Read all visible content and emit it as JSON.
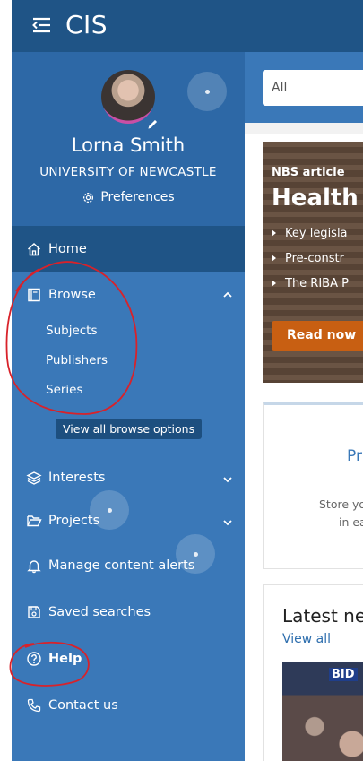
{
  "app": {
    "title": "CIS"
  },
  "profile": {
    "name": "Lorna Smith",
    "organization": "UNIVERSITY OF NEWCASTLE",
    "preferences_label": "Preferences"
  },
  "nav": {
    "home": "Home",
    "browse": {
      "label": "Browse",
      "items": [
        "Subjects",
        "Publishers",
        "Series"
      ],
      "view_all": "View all browse options"
    },
    "interests": "Interests",
    "projects": "Projects",
    "alerts": "Manage content alerts",
    "saved_searches": "Saved searches",
    "help": "Help",
    "contact": "Contact us"
  },
  "search": {
    "scope": "All"
  },
  "article": {
    "kicker": "NBS article",
    "title": "Health",
    "bullets": [
      "Key legisla",
      "Pre-constr",
      "The RIBA P"
    ],
    "cta": "Read now"
  },
  "promo": {
    "title": "Pr",
    "text_line1": "Store yo",
    "text_line2": "in ea"
  },
  "news": {
    "title": "Latest ne",
    "view_all": "View all",
    "image_text": "BID"
  },
  "colors": {
    "sidebar": "#3a78b8",
    "topbar": "#1f5486",
    "profile_bg": "#2d68a6",
    "cta": "#c85f12",
    "annotation": "#d8222a"
  },
  "icons": {
    "menu": "menu-collapse-icon",
    "edit": "pencil-icon",
    "preferences": "gear-icon",
    "home": "home-icon",
    "browse": "book-icon",
    "interests": "layers-icon",
    "projects": "folder-open-icon",
    "alerts": "bell-icon",
    "saved": "save-icon",
    "help": "help-circle-icon",
    "contact": "phone-icon"
  }
}
